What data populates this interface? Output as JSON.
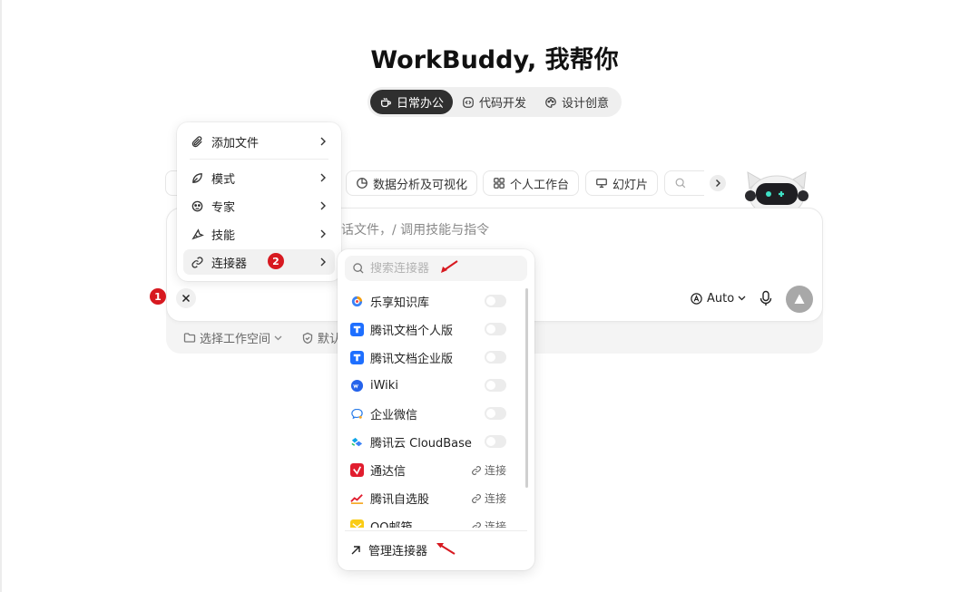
{
  "app": {
    "title": "WorkBuddy, 我帮你"
  },
  "mode_tabs": [
    {
      "label": "日常办公",
      "icon": "cup-icon",
      "active": true
    },
    {
      "label": "代码开发",
      "icon": "code-icon",
      "active": false
    },
    {
      "label": "设计创意",
      "icon": "palette-icon",
      "active": false
    }
  ],
  "chips": [
    {
      "label": "数据分析及可视化",
      "icon": "pie-chart-icon"
    },
    {
      "label": "个人工作台",
      "icon": "grid-icon"
    },
    {
      "label": "幻灯片",
      "icon": "presentation-icon"
    }
  ],
  "input": {
    "placeholder": "话文件，/ 调用技能与指令",
    "model": "Auto"
  },
  "footer": {
    "workspace_label": "选择工作空间",
    "default_label": "默认"
  },
  "menu": {
    "items": [
      {
        "label": "添加文件",
        "icon": "paperclip-icon"
      },
      {
        "label": "模式",
        "icon": "leaf-icon"
      },
      {
        "label": "专家",
        "icon": "expert-icon"
      },
      {
        "label": "技能",
        "icon": "skill-icon"
      },
      {
        "label": "连接器",
        "icon": "link-icon",
        "active": true
      }
    ]
  },
  "badges": {
    "one": "1",
    "two": "2"
  },
  "connectors": {
    "search_placeholder": "搜索连接器",
    "items": [
      {
        "label": "乐享知识库",
        "state": "toggle"
      },
      {
        "label": "腾讯文档个人版",
        "state": "toggle"
      },
      {
        "label": "腾讯文档企业版",
        "state": "toggle"
      },
      {
        "label": "iWiki",
        "state": "toggle"
      },
      {
        "label": "企业微信",
        "state": "toggle"
      },
      {
        "label": "腾讯云 CloudBase",
        "state": "toggle"
      },
      {
        "label": "通达信",
        "state": "link"
      },
      {
        "label": "腾讯自选股",
        "state": "link"
      },
      {
        "label": "QQ邮箱",
        "state": "link"
      }
    ],
    "connect_label": "连接",
    "manage_label": "管理连接器"
  },
  "colors": {
    "accent_dark": "#2f2f2f",
    "badge_red": "#d71920",
    "send_gray": "#a8a8a8"
  }
}
